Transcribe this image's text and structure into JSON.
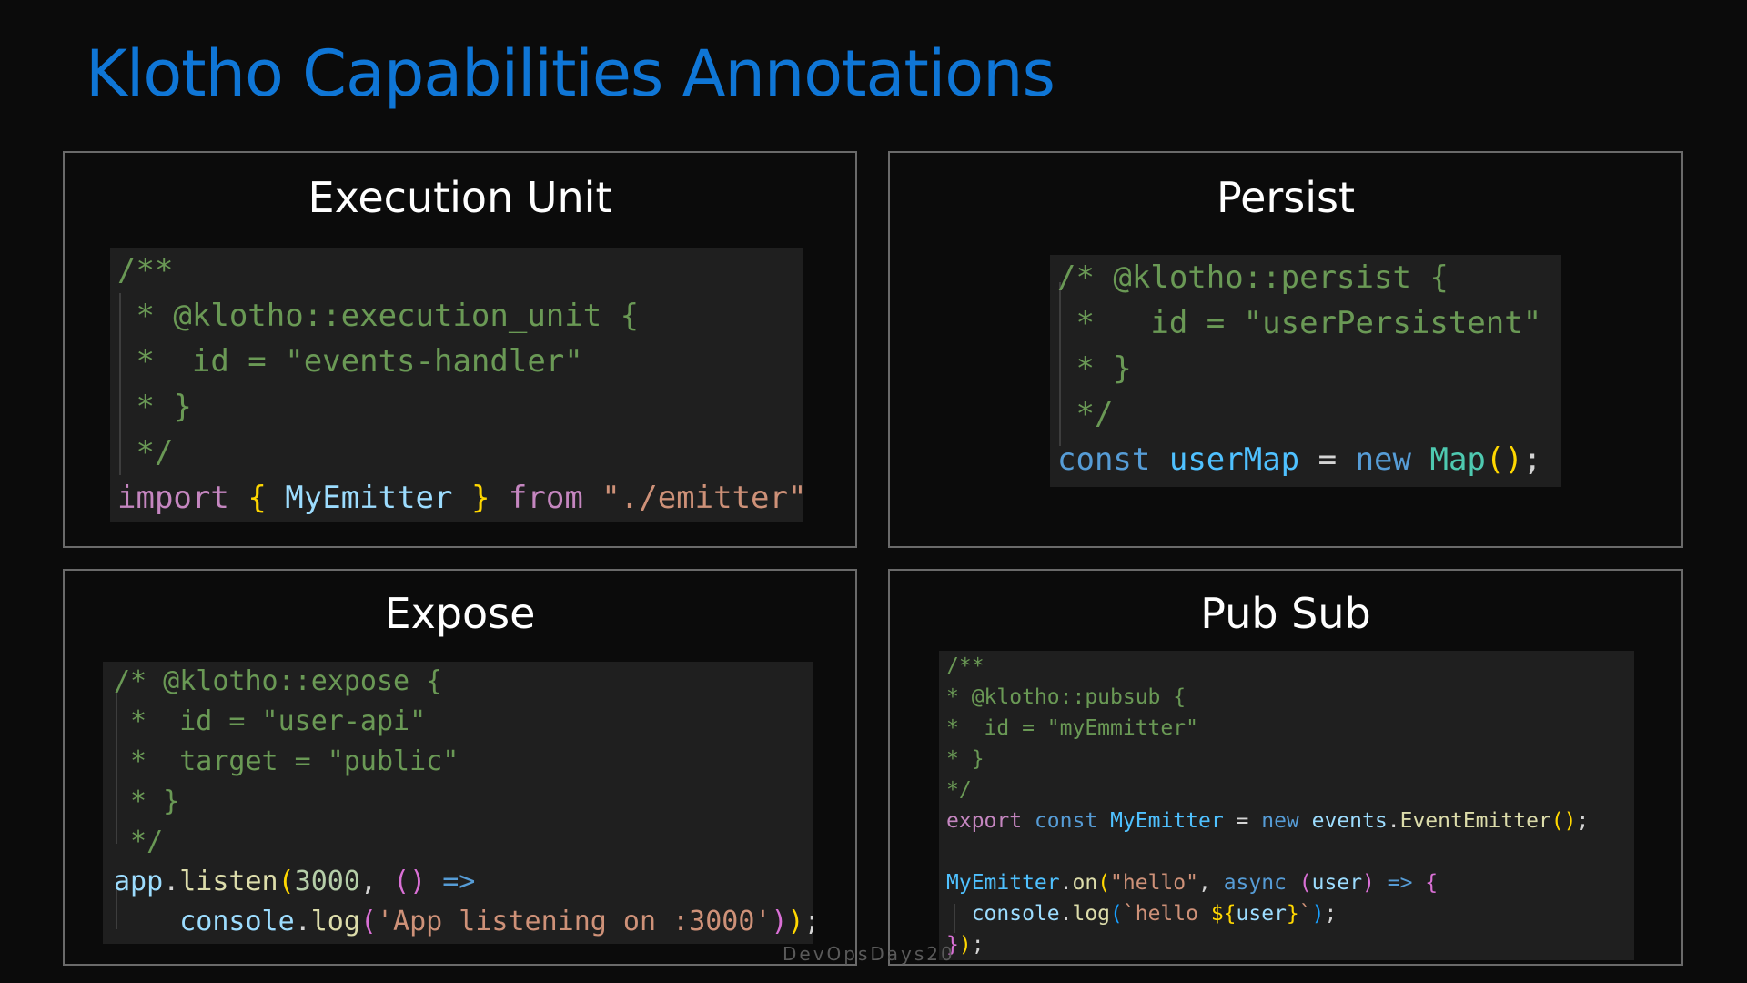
{
  "title": "Klotho Capabilities Annotations",
  "footer": "DevOpsDays20",
  "colors": {
    "background": "#0b0b0b",
    "title": "#0f76d6",
    "panel_border": "#6a6a6a",
    "code_bg": "#1f1f1f"
  },
  "panels": {
    "execution_unit": {
      "title": "Execution Unit",
      "code": [
        [
          {
            "t": "/**",
            "c": "c-com"
          }
        ],
        [
          {
            "t": " * @klotho::execution_unit {",
            "c": "c-com"
          }
        ],
        [
          {
            "t": " *  id = \"events-handler\"",
            "c": "c-com"
          }
        ],
        [
          {
            "t": " * }",
            "c": "c-com"
          }
        ],
        [
          {
            "t": " */",
            "c": "c-com"
          }
        ],
        [
          {
            "t": "import",
            "c": "c-kw"
          },
          {
            "t": " ",
            "c": "c-op"
          },
          {
            "t": "{",
            "c": "c-p1"
          },
          {
            "t": " MyEmitter ",
            "c": "c-ident"
          },
          {
            "t": "}",
            "c": "c-p1"
          },
          {
            "t": " from ",
            "c": "c-kw"
          },
          {
            "t": "\"./emitter\"",
            "c": "c-str"
          }
        ]
      ]
    },
    "persist": {
      "title": "Persist",
      "code": [
        [
          {
            "t": "/* @klotho::persist {",
            "c": "c-com"
          }
        ],
        [
          {
            "t": " *   id = \"userPersistent\"",
            "c": "c-com"
          }
        ],
        [
          {
            "t": " * }",
            "c": "c-com"
          }
        ],
        [
          {
            "t": " */",
            "c": "c-com"
          }
        ],
        [
          {
            "t": "const",
            "c": "c-decl"
          },
          {
            "t": " ",
            "c": "c-op"
          },
          {
            "t": "userMap",
            "c": "c-var"
          },
          {
            "t": " = ",
            "c": "c-op"
          },
          {
            "t": "new",
            "c": "c-decl"
          },
          {
            "t": " ",
            "c": "c-op"
          },
          {
            "t": "Map",
            "c": "c-cls"
          },
          {
            "t": "()",
            "c": "c-p1"
          },
          {
            "t": ";",
            "c": "c-punc"
          }
        ]
      ]
    },
    "expose": {
      "title": "Expose",
      "code": [
        [
          {
            "t": "/* @klotho::expose {",
            "c": "c-com"
          }
        ],
        [
          {
            "t": " *  id = \"user-api\"",
            "c": "c-com"
          }
        ],
        [
          {
            "t": " *  target = \"public\"",
            "c": "c-com"
          }
        ],
        [
          {
            "t": " * }",
            "c": "c-com"
          }
        ],
        [
          {
            "t": " */",
            "c": "c-com"
          }
        ],
        [
          {
            "t": "app",
            "c": "c-ident"
          },
          {
            "t": ".",
            "c": "c-punc"
          },
          {
            "t": "listen",
            "c": "c-fn"
          },
          {
            "t": "(",
            "c": "c-p1"
          },
          {
            "t": "3000",
            "c": "c-num"
          },
          {
            "t": ", ",
            "c": "c-punc"
          },
          {
            "t": "()",
            "c": "c-p2"
          },
          {
            "t": " => ",
            "c": "c-decl"
          }
        ],
        [
          {
            "t": "    console",
            "c": "c-ident"
          },
          {
            "t": ".",
            "c": "c-punc"
          },
          {
            "t": "log",
            "c": "c-fn"
          },
          {
            "t": "(",
            "c": "c-p2"
          },
          {
            "t": "'App listening on :3000'",
            "c": "c-str"
          },
          {
            "t": ")",
            "c": "c-p2"
          },
          {
            "t": ")",
            "c": "c-p1"
          },
          {
            "t": ";",
            "c": "c-punc"
          }
        ]
      ]
    },
    "pubsub": {
      "title": "Pub Sub",
      "code": [
        [
          {
            "t": "/**",
            "c": "c-com"
          }
        ],
        [
          {
            "t": "* @klotho::pubsub {",
            "c": "c-com"
          }
        ],
        [
          {
            "t": "*  id = \"myEmmitter\"",
            "c": "c-com"
          }
        ],
        [
          {
            "t": "* }",
            "c": "c-com"
          }
        ],
        [
          {
            "t": "*/",
            "c": "c-com"
          }
        ],
        [
          {
            "t": "export",
            "c": "c-kw"
          },
          {
            "t": " ",
            "c": "c-op"
          },
          {
            "t": "const",
            "c": "c-decl"
          },
          {
            "t": " ",
            "c": "c-op"
          },
          {
            "t": "MyEmitter",
            "c": "c-var"
          },
          {
            "t": " = ",
            "c": "c-op"
          },
          {
            "t": "new",
            "c": "c-decl"
          },
          {
            "t": " ",
            "c": "c-op"
          },
          {
            "t": "events",
            "c": "c-ident"
          },
          {
            "t": ".",
            "c": "c-punc"
          },
          {
            "t": "EventEmitter",
            "c": "c-fn"
          },
          {
            "t": "()",
            "c": "c-p1"
          },
          {
            "t": ";",
            "c": "c-punc"
          }
        ],
        [
          {
            "t": " ",
            "c": "c-op"
          }
        ],
        [
          {
            "t": "MyEmitter",
            "c": "c-var"
          },
          {
            "t": ".",
            "c": "c-punc"
          },
          {
            "t": "on",
            "c": "c-fn"
          },
          {
            "t": "(",
            "c": "c-p1"
          },
          {
            "t": "\"hello\"",
            "c": "c-str"
          },
          {
            "t": ", ",
            "c": "c-punc"
          },
          {
            "t": "async",
            "c": "c-decl"
          },
          {
            "t": " ",
            "c": "c-op"
          },
          {
            "t": "(",
            "c": "c-p2"
          },
          {
            "t": "user",
            "c": "c-ident"
          },
          {
            "t": ")",
            "c": "c-p2"
          },
          {
            "t": " => ",
            "c": "c-decl"
          },
          {
            "t": "{",
            "c": "c-p2"
          }
        ],
        [
          {
            "t": "  console",
            "c": "c-ident"
          },
          {
            "t": ".",
            "c": "c-punc"
          },
          {
            "t": "log",
            "c": "c-fn"
          },
          {
            "t": "(",
            "c": "c-p3"
          },
          {
            "t": "`hello ",
            "c": "c-str"
          },
          {
            "t": "${",
            "c": "c-p1"
          },
          {
            "t": "user",
            "c": "c-ident"
          },
          {
            "t": "}",
            "c": "c-p1"
          },
          {
            "t": "`",
            "c": "c-str"
          },
          {
            "t": ")",
            "c": "c-p3"
          },
          {
            "t": ";",
            "c": "c-punc"
          }
        ],
        [
          {
            "t": "}",
            "c": "c-p2"
          },
          {
            "t": ")",
            "c": "c-p1"
          },
          {
            "t": ";",
            "c": "c-punc"
          }
        ]
      ]
    }
  }
}
